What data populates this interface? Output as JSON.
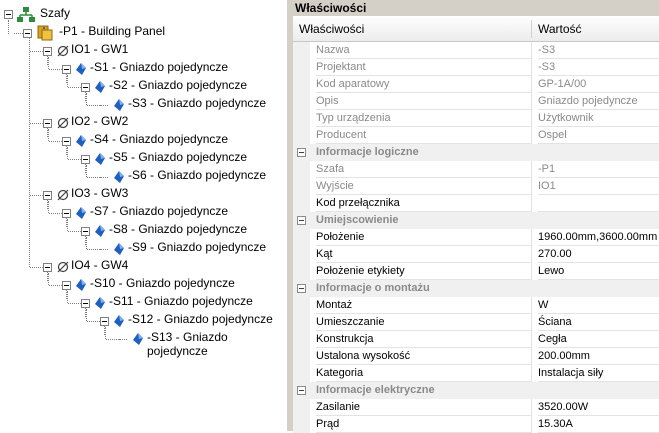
{
  "tree": {
    "root": "Szafy",
    "nodes": [
      {
        "id": "p1",
        "label": "-P1 - Building Panel",
        "icon": "panel-icon"
      },
      {
        "id": "io1",
        "label": "IO1 - GW1",
        "icon": "circuit-icon"
      },
      {
        "id": "s1",
        "label": "-S1 - Gniazdo pojedyncze",
        "icon": "socket-icon"
      },
      {
        "id": "s2",
        "label": "-S2 - Gniazdo pojedyncze",
        "icon": "socket-icon"
      },
      {
        "id": "s3",
        "label": "-S3 - Gniazdo pojedyncze",
        "icon": "socket-icon"
      },
      {
        "id": "io2",
        "label": "IO2 - GW2",
        "icon": "circuit-icon"
      },
      {
        "id": "s4",
        "label": "-S4 - Gniazdo pojedyncze",
        "icon": "socket-icon"
      },
      {
        "id": "s5",
        "label": "-S5 - Gniazdo pojedyncze",
        "icon": "socket-icon"
      },
      {
        "id": "s6",
        "label": "-S6 - Gniazdo pojedyncze",
        "icon": "socket-icon"
      },
      {
        "id": "io3",
        "label": "IO3 - GW3",
        "icon": "circuit-icon"
      },
      {
        "id": "s7",
        "label": "-S7 - Gniazdo pojedyncze",
        "icon": "socket-icon"
      },
      {
        "id": "s8",
        "label": "-S8 - Gniazdo pojedyncze",
        "icon": "socket-icon"
      },
      {
        "id": "s9",
        "label": "-S9 - Gniazdo pojedyncze",
        "icon": "socket-icon"
      },
      {
        "id": "io4",
        "label": "IO4 - GW4",
        "icon": "circuit-icon"
      },
      {
        "id": "s10",
        "label": "-S10 - Gniazdo pojedyncze",
        "icon": "socket-icon"
      },
      {
        "id": "s11",
        "label": "-S11 - Gniazdo pojedyncze",
        "icon": "socket-icon"
      },
      {
        "id": "s12",
        "label": "-S12 - Gniazdo pojedyncze",
        "icon": "socket-icon"
      },
      {
        "id": "s13",
        "label": "-S13 - Gniazdo pojedyncze",
        "icon": "socket-icon"
      }
    ]
  },
  "properties": {
    "title": "Właściwości",
    "col_name": "Właściwości",
    "col_value": "Wartość",
    "general": [
      {
        "name": "Nazwa",
        "value": "-S3"
      },
      {
        "name": "Projektant",
        "value": "-S3"
      },
      {
        "name": "Kod aparatowy",
        "value": "GP-1A/00"
      },
      {
        "name": "Opis",
        "value": "Gniazdo pojedyncze"
      },
      {
        "name": "Typ urządzenia",
        "value": "Użytkownik"
      },
      {
        "name": "Producent",
        "value": "Ospel"
      }
    ],
    "logical": {
      "label": "Informacje logiczne",
      "rows": [
        {
          "name": "Szafa",
          "value": "-P1"
        },
        {
          "name": "Wyjście",
          "value": "IO1"
        },
        {
          "name": "Kod przełącznika",
          "value": ""
        }
      ]
    },
    "placement": {
      "label": "Umiejscowienie",
      "rows": [
        {
          "name": "Położenie",
          "value": "1960.00mm,3600.00mm"
        },
        {
          "name": "Kąt",
          "value": "270.00"
        },
        {
          "name": "Położenie etykiety",
          "value": "Lewo"
        }
      ]
    },
    "mounting": {
      "label": "Informacje o montażu",
      "rows": [
        {
          "name": "Montaż",
          "value": "W"
        },
        {
          "name": "Umieszczanie",
          "value": "Ściana"
        },
        {
          "name": "Konstrukcja",
          "value": "Cegła"
        },
        {
          "name": "Ustalona wysokość",
          "value": "200.00mm"
        },
        {
          "name": "Kategoria",
          "value": "Instalacja siły"
        }
      ]
    },
    "electrical": {
      "label": "Informacje elektryczne",
      "rows": [
        {
          "name": "Zasilanie",
          "value": "3520.00W"
        },
        {
          "name": "Prąd",
          "value": "15.30A"
        }
      ]
    }
  },
  "colors": {
    "socket": "#1f5fbf",
    "panel": "#d9a21b",
    "root": "#2e8b3a"
  }
}
